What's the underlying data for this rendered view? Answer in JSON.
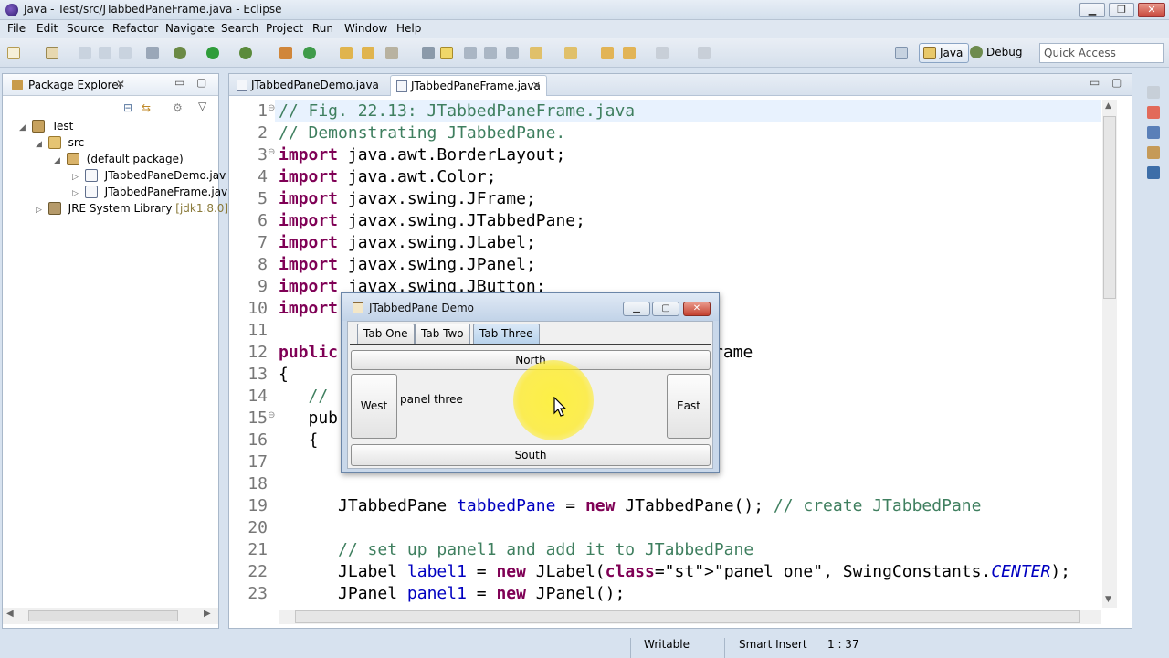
{
  "window": {
    "title": "Java - Test/src/JTabbedPaneFrame.java - Eclipse"
  },
  "menu": [
    "File",
    "Edit",
    "Source",
    "Refactor",
    "Navigate",
    "Search",
    "Project",
    "Run",
    "Window",
    "Help"
  ],
  "toolbar": {
    "perspectives": [
      {
        "label": "Java",
        "active": true
      },
      {
        "label": "Debug",
        "active": false
      }
    ],
    "quick_access_placeholder": "Quick Access"
  },
  "package_explorer": {
    "title": "Package Explorer",
    "tree": [
      {
        "label": "Test",
        "depth": 0,
        "icon": "project-icon",
        "expanded": true
      },
      {
        "label": "src",
        "depth": 1,
        "icon": "source-folder-icon",
        "expanded": true
      },
      {
        "label": "(default package)",
        "depth": 2,
        "icon": "package-icon",
        "expanded": true
      },
      {
        "label": "JTabbedPaneDemo.jav",
        "depth": 3,
        "icon": "java-file-icon",
        "expanded": false
      },
      {
        "label": "JTabbedPaneFrame.jav",
        "depth": 3,
        "icon": "java-file-icon",
        "expanded": false
      },
      {
        "label": "JRE System Library",
        "extra": "[jdk1.8.0]",
        "depth": 0,
        "icon": "library-icon",
        "expanded": false
      }
    ]
  },
  "editor": {
    "tabs": [
      {
        "label": "JTabbedPaneDemo.java",
        "active": false
      },
      {
        "label": "JTabbedPaneFrame.java",
        "active": true
      }
    ],
    "line_numbers": [
      "1",
      "2",
      "3",
      "4",
      "5",
      "6",
      "7",
      "8",
      "9",
      "10",
      "11",
      "12",
      "13",
      "14",
      "15",
      "16",
      "17",
      "18",
      "19",
      "20",
      "21",
      "22",
      "23"
    ],
    "lines": [
      "// Fig. 22.13: JTabbedPaneFrame.java",
      "// Demonstrating JTabbedPane.",
      "import java.awt.BorderLayout;",
      "import java.awt.Color;",
      "import javax.swing.JFrame;",
      "import javax.swing.JTabbedPane;",
      "import javax.swing.JLabel;",
      "import javax.swing.JPanel;",
      "import javax.swing.JButton;",
      "import",
      "",
      "public",
      "{",
      "   //",
      "   pub",
      "   {",
      "",
      "",
      "      JTabbedPane tabbedPane = new JTabbedPane(); // create JTabbedPane",
      "",
      "      // set up panel1 and add it to JTabbedPane",
      "      JLabel label1 = new JLabel(\"panel one\", SwingConstants.CENTER);",
      "      JPanel panel1 = new JPanel();"
    ],
    "partial_text_line12": "rame"
  },
  "swing_demo": {
    "title": "JTabbedPane Demo",
    "tabs": [
      "Tab One",
      "Tab Two",
      "Tab Three"
    ],
    "selected_tab": "Tab Three",
    "buttons": {
      "north": "North",
      "west": "West",
      "east": "East",
      "south": "South"
    },
    "center_label": "panel three"
  },
  "status": {
    "mode": "Writable",
    "insert": "Smart Insert",
    "position": "1 : 37"
  },
  "colors": {
    "keyword": "#7f0055",
    "comment": "#3f7f5f",
    "string": "#2a00ff",
    "field": "#0000c0",
    "highlight": "#ffec1e"
  }
}
